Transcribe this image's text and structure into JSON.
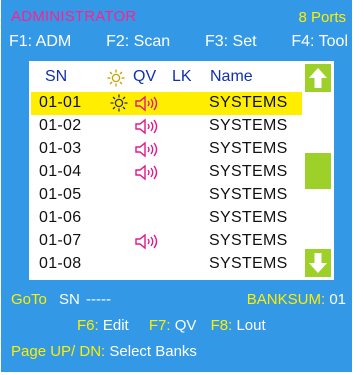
{
  "header": {
    "title": "ADMINISTRATOR",
    "ports": "8 Ports"
  },
  "fkeys": [
    "F1: ADM",
    "F2: Scan",
    "F3: Set",
    "F4: Tool"
  ],
  "columns": {
    "sn": "SN",
    "qv": "QV",
    "lk": "LK",
    "name": "Name",
    "sun_icon": "sun-icon"
  },
  "rows": [
    {
      "sn": "01-01",
      "name": "SYSTEMS",
      "selected": true,
      "sun": true,
      "qv": true
    },
    {
      "sn": "01-02",
      "name": "SYSTEMS",
      "selected": false,
      "sun": false,
      "qv": true
    },
    {
      "sn": "01-03",
      "name": "SYSTEMS",
      "selected": false,
      "sun": false,
      "qv": true
    },
    {
      "sn": "01-04",
      "name": "SYSTEMS",
      "selected": false,
      "sun": false,
      "qv": true
    },
    {
      "sn": "01-05",
      "name": "SYSTEMS",
      "selected": false,
      "sun": false,
      "qv": false
    },
    {
      "sn": "01-06",
      "name": "SYSTEMS",
      "selected": false,
      "sun": false,
      "qv": false
    },
    {
      "sn": "01-07",
      "name": "SYSTEMS",
      "selected": false,
      "sun": false,
      "qv": true
    },
    {
      "sn": "01-08",
      "name": "SYSTEMS",
      "selected": false,
      "sun": false,
      "qv": false
    }
  ],
  "scrollbar": {
    "up_icon": "arrow-up-icon",
    "down_icon": "arrow-down-icon",
    "colors": {
      "bar": "#9dd12a"
    }
  },
  "footer": {
    "goto_label": "GoTo",
    "sn_label": "SN",
    "sn_value": "-----",
    "banksum_label": "BANKSUM:",
    "banksum_value": "01",
    "f6_key": "F6:",
    "f6_label": "Edit",
    "f7_key": "F7:",
    "f7_label": "QV",
    "f8_key": "F8:",
    "f8_label": "Lout",
    "page_key": "Page UP/ DN:",
    "page_label": "Select Banks"
  },
  "colors": {
    "background": "#3399e6",
    "accent_yellow": "#ffee00",
    "title_pink": "#ff1f8f",
    "volume_icon": "#e0188c"
  }
}
